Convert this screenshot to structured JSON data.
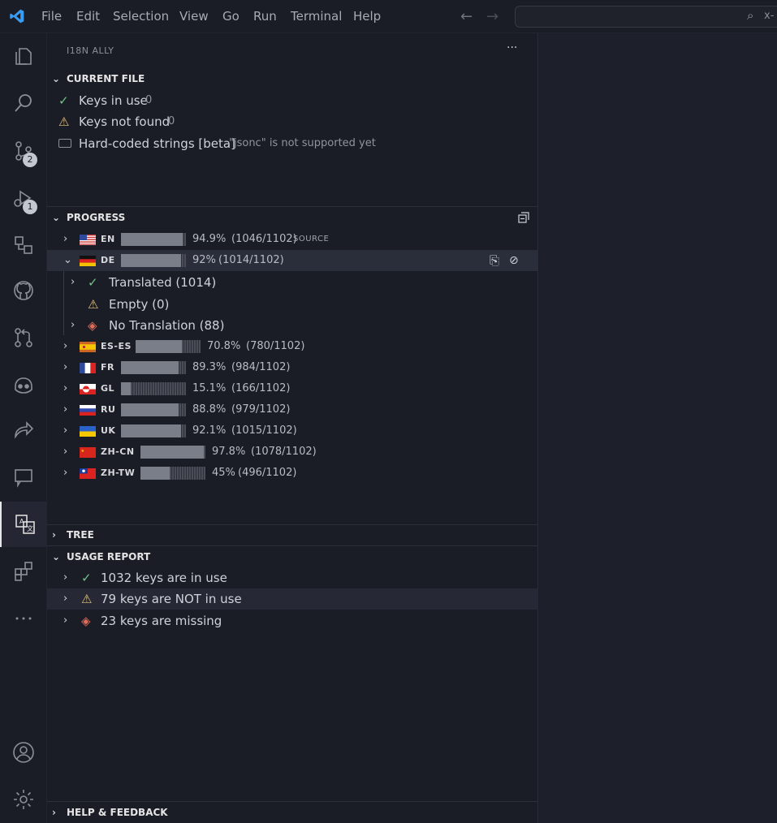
{
  "titlebar": {
    "menu": [
      "File",
      "Edit",
      "Selection",
      "View",
      "Go",
      "Run",
      "Terminal",
      "Help"
    ],
    "search_text": "x-",
    "back_icon": "arrow-left-icon",
    "forward_icon": "arrow-right-icon"
  },
  "activity_bar": {
    "items": [
      {
        "name": "explorer-icon"
      },
      {
        "name": "search-icon"
      },
      {
        "name": "source-control-icon",
        "badge": "2"
      },
      {
        "name": "run-debug-icon",
        "badge": "1"
      },
      {
        "name": "remote-explorer-icon"
      },
      {
        "name": "github-icon"
      },
      {
        "name": "pull-request-icon"
      },
      {
        "name": "copilot-icon"
      },
      {
        "name": "live-share-icon"
      },
      {
        "name": "comments-icon"
      },
      {
        "name": "i18n-ally-icon",
        "active": true
      },
      {
        "name": "extensions-icon"
      },
      {
        "name": "more-icon"
      }
    ],
    "bottom": [
      {
        "name": "account-icon"
      },
      {
        "name": "manage-gear-icon"
      }
    ]
  },
  "sidebar": {
    "title": "I18N ALLY",
    "more_label": "···",
    "current_file": {
      "title": "CURRENT FILE",
      "keys_in_use_label": "Keys in use",
      "keys_in_use_count": "0",
      "keys_not_found_label": "Keys not found",
      "keys_not_found_count": "0",
      "hardcoded_label": "Hard-coded strings [beta]",
      "hardcoded_note": "\"jsonc\" is not supported yet"
    },
    "progress": {
      "title": "PROGRESS",
      "locales": [
        {
          "code": "EN",
          "percent": "94.9%",
          "counts": "(1046/1102)",
          "source": "SOURCE",
          "fraction": 0.949
        },
        {
          "code": "DE",
          "percent": "92%",
          "counts": "(1014/1102)",
          "fraction": 0.92,
          "expanded": true
        },
        {
          "code": "ES-ES",
          "percent": "70.8%",
          "counts": "(780/1102)",
          "fraction": 0.708
        },
        {
          "code": "FR",
          "percent": "89.3%",
          "counts": "(984/1102)",
          "fraction": 0.893
        },
        {
          "code": "GL",
          "percent": "15.1%",
          "counts": "(166/1102)",
          "fraction": 0.151
        },
        {
          "code": "RU",
          "percent": "88.8%",
          "counts": "(979/1102)",
          "fraction": 0.888
        },
        {
          "code": "UK",
          "percent": "92.1%",
          "counts": "(1015/1102)",
          "fraction": 0.921
        },
        {
          "code": "ZH-CN",
          "percent": "97.8%",
          "counts": "(1078/1102)",
          "fraction": 0.978
        },
        {
          "code": "ZH-TW",
          "percent": "45%",
          "counts": "(496/1102)",
          "fraction": 0.45
        }
      ],
      "de_children": {
        "translated": "Translated (1014)",
        "empty": "Empty (0)",
        "no_translation": "No Translation (88)"
      }
    },
    "tree": {
      "title": "TREE"
    },
    "usage_report": {
      "title": "USAGE REPORT",
      "in_use": "1032 keys are in use",
      "not_in_use": "79 keys are NOT in use",
      "missing": "23 keys are missing"
    },
    "help": {
      "title": "HELP & FEEDBACK"
    }
  },
  "colors": {
    "ok": "#6fc487",
    "warn": "#e5c07b",
    "err": "#e06c5a",
    "accent": "#3794ff"
  }
}
